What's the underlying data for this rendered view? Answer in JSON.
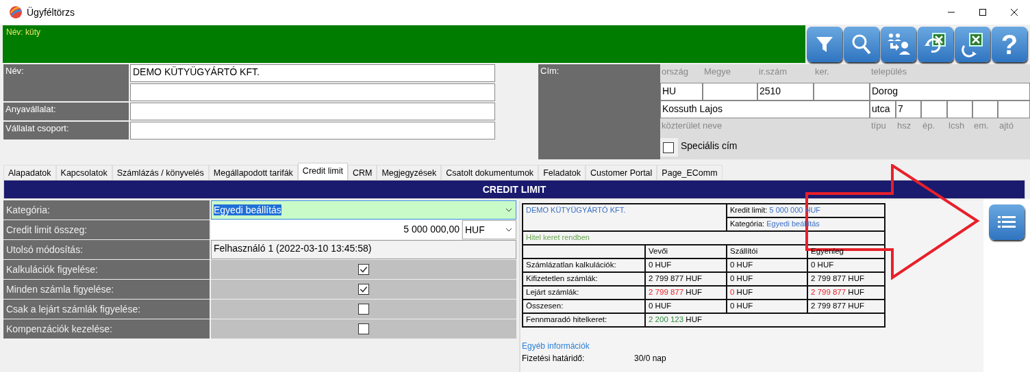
{
  "window": {
    "title": "Ügyféltörzs"
  },
  "filter_text": "Név: küty",
  "toolbar": [
    {
      "kind": "filter"
    },
    {
      "kind": "search"
    },
    {
      "kind": "transfer"
    },
    {
      "kind": "import"
    },
    {
      "kind": "export"
    },
    {
      "kind": "help",
      "glyph": "?"
    }
  ],
  "company_form": [
    {
      "label": "Név:",
      "kind": "double",
      "value": "DEMO KÜTYÜGYÁRTÓ KFT."
    },
    {
      "label": "Anyavállalat:",
      "kind": "single"
    },
    {
      "label": "Vállalat csoport:",
      "kind": "single"
    }
  ],
  "address": {
    "label": "Cím:",
    "top_labels": [
      "ország",
      "Megye",
      "ir.szám",
      "ker.",
      "település"
    ],
    "values": {
      "country": "HU",
      "zip": "2510",
      "city": "Dorog",
      "street": "Kossuth Lajos",
      "street_type": "utca",
      "house_number": "7"
    },
    "bottom_labels": [
      "közterület neve",
      "típu",
      "hsz",
      "ép.",
      "lcsh",
      "em.",
      "ajtó"
    ],
    "special": {
      "label": "Speciális cím",
      "checked": false
    }
  },
  "tabs": [
    {
      "label": "Alapadatok",
      "selected": false
    },
    {
      "label": "Kapcsolatok",
      "selected": false
    },
    {
      "label": "Számlázás / könyvelés",
      "selected": false
    },
    {
      "label": "Megállapodott tarifák",
      "selected": false
    },
    {
      "label": "Credit limit",
      "selected": true
    },
    {
      "label": "CRM",
      "selected": false
    },
    {
      "label": "Megjegyzések",
      "selected": false
    },
    {
      "label": "Csatolt dokumentumok",
      "selected": false
    },
    {
      "label": "Feladatok",
      "selected": false
    },
    {
      "label": "Customer Portal",
      "selected": false
    },
    {
      "label": "Page_EComm",
      "selected": false
    }
  ],
  "credit": {
    "title": "CREDIT LIMIT",
    "rows": [
      {
        "label": "Kategória:",
        "kind": "select",
        "value": "Egyedi beállítás"
      },
      {
        "label": "Credit limit összeg:",
        "kind": "amount",
        "value": "5 000 000,00",
        "currency": "HUF"
      },
      {
        "label": "Utolsó módosítás:",
        "kind": "text",
        "value": "Felhasználó 1 (2022-03-10 13:45:58)"
      },
      {
        "label": "Kalkulációk figyelése:",
        "kind": "checkbox",
        "checked": true
      },
      {
        "label": "Minden számla figyelése:",
        "kind": "checkbox",
        "checked": true
      },
      {
        "label": "Csak a lejárt számlák figyelése:",
        "kind": "checkbox",
        "checked": false
      },
      {
        "label": "Kompenzációk kezelése:",
        "kind": "checkbox",
        "checked": false
      }
    ],
    "summary": {
      "company": "DEMO KÜTYÜGYÁRTÓ KFT.",
      "limit_label": "Kredit limit:",
      "limit_value": "5 000 000 HUF",
      "category_label": "Kategória:",
      "category_value": "Egyedi beállítás",
      "status": "Hitel keret rendben",
      "columns": [
        "Vevői",
        "Szállítói",
        "Egyenleg"
      ],
      "rows": [
        {
          "label": "Számlázatlan kalkulációk:",
          "cells": [
            {
              "amount": "0",
              "unit": "HUF",
              "kind": "plain"
            },
            {
              "amount": "0",
              "unit": "HUF",
              "kind": "plain"
            },
            {
              "amount": "0",
              "unit": "HUF",
              "kind": "plain"
            }
          ]
        },
        {
          "label": "Kifizetetlen számlák:",
          "cells": [
            {
              "amount": "2 799 877",
              "unit": "HUF",
              "kind": "plain"
            },
            {
              "amount": "0",
              "unit": "HUF",
              "kind": "plain"
            },
            {
              "amount": "2 799 877",
              "unit": "HUF",
              "kind": "plain"
            }
          ]
        },
        {
          "label": "Lejárt számlák:",
          "cells": [
            {
              "amount": "2 799 877",
              "unit": "HUF",
              "kind": "overdue"
            },
            {
              "amount": "0",
              "unit": "HUF",
              "kind": "overdue"
            },
            {
              "amount": "2 799 877",
              "unit": "HUF",
              "kind": "overdue"
            }
          ]
        },
        {
          "label": "Összesen:",
          "cells": [
            {
              "amount": "0",
              "unit": "HUF",
              "kind": "plain"
            },
            {
              "amount": "0",
              "unit": "HUF",
              "kind": "plain"
            },
            {
              "amount": "2 799 877",
              "unit": "HUF",
              "kind": "plain"
            }
          ]
        }
      ],
      "remaining": {
        "label": "Fennmaradó hitelkeret:",
        "amount": "2 200 123",
        "unit": "HUF",
        "kind": "ok"
      }
    },
    "other": {
      "title": "Egyéb információk",
      "rows": [
        {
          "label": "Fizetési határidő:",
          "value": "30/0 nap"
        }
      ]
    }
  }
}
